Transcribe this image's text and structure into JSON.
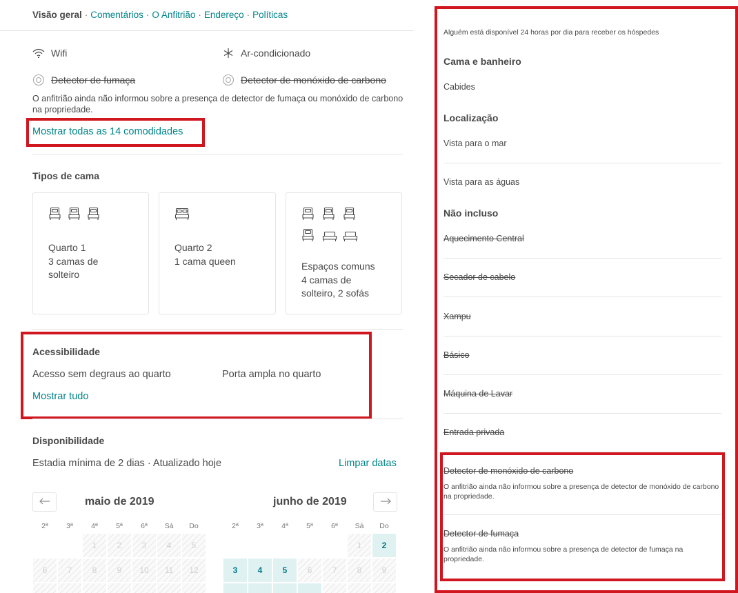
{
  "nav": {
    "overview": "Visão geral",
    "sep": "·",
    "comments": "Comentários",
    "host": "O Anfitrião",
    "address": "Endereço",
    "policies": "Políticas"
  },
  "amenities": {
    "wifi": "Wifi",
    "ac": "Ar-condicionado",
    "smoke": "Detector de fumaça",
    "co": "Detector de monóxido de carbono",
    "note": "O anfitrião ainda não informou sobre a presença de detector de fumaça ou monóxido de carbono na propriedade.",
    "show_all": "Mostrar todas as 14 comodidades"
  },
  "beds": {
    "title": "Tipos de cama",
    "rooms": [
      {
        "name": "Quarto 1",
        "desc": "3 camas de solteiro"
      },
      {
        "name": "Quarto 2",
        "desc": "1 cama queen"
      },
      {
        "name": "Espaços comuns",
        "desc": "4 camas de solteiro, 2 sofás"
      }
    ]
  },
  "accessibility": {
    "title": "Acessibilidade",
    "items": [
      "Acesso sem degraus ao quarto",
      "Porta ampla no quarto"
    ],
    "show_all": "Mostrar tudo"
  },
  "availability": {
    "title": "Disponibilidade",
    "subtitle": "Estadia mínima de 2 dias · Atualizado hoje",
    "clear": "Limpar datas",
    "prev_icon": "arrow-left-icon",
    "next_icon": "arrow-right-icon",
    "months": [
      {
        "label": "maio de 2019",
        "weekdays": [
          "2ª",
          "3ª",
          "4ª",
          "5ª",
          "6ª",
          "Sá",
          "Do"
        ],
        "rows": [
          [
            null,
            null,
            "1",
            "2",
            "3",
            "4",
            "5"
          ],
          [
            "6",
            "7",
            "8",
            "9",
            "10",
            "11",
            "12"
          ]
        ]
      },
      {
        "label": "junho de 2019",
        "weekdays": [
          "2ª",
          "3ª",
          "4ª",
          "5ª",
          "6ª",
          "Sá",
          "Do"
        ],
        "rows": [
          [
            null,
            null,
            null,
            null,
            null,
            "1",
            "2"
          ],
          [
            "3",
            "4",
            "5",
            "6",
            "7",
            "8",
            "9"
          ]
        ]
      }
    ]
  },
  "panel": {
    "host_note": "Alguém está disponível 24 horas por dia para receber os hóspedes",
    "bed_bath_title": "Cama e banheiro",
    "hangers": "Cabides",
    "location_title": "Localização",
    "sea_view": "Vista para o mar",
    "water_view": "Vista para as águas",
    "not_included_title": "Não incluso",
    "not_included": [
      "Aquecimento Central",
      "Secador de cabelo",
      "Xampu",
      "Básico",
      "Máquina de Lavar",
      "Entrada privada"
    ],
    "co_title": "Detector de monóxido de carbono",
    "co_note": "O anfitrião ainda não informou sobre a presença de detector de monóxido de carbono na propriedade.",
    "smoke_title": "Detector de fumaça",
    "smoke_note": "O anfitrião ainda não informou sobre a presença de detector de fumaça na propriedade."
  },
  "colors": {
    "teal": "#008489",
    "highlight_red": "#d0161f",
    "available_bg": "#e0f1f2"
  }
}
